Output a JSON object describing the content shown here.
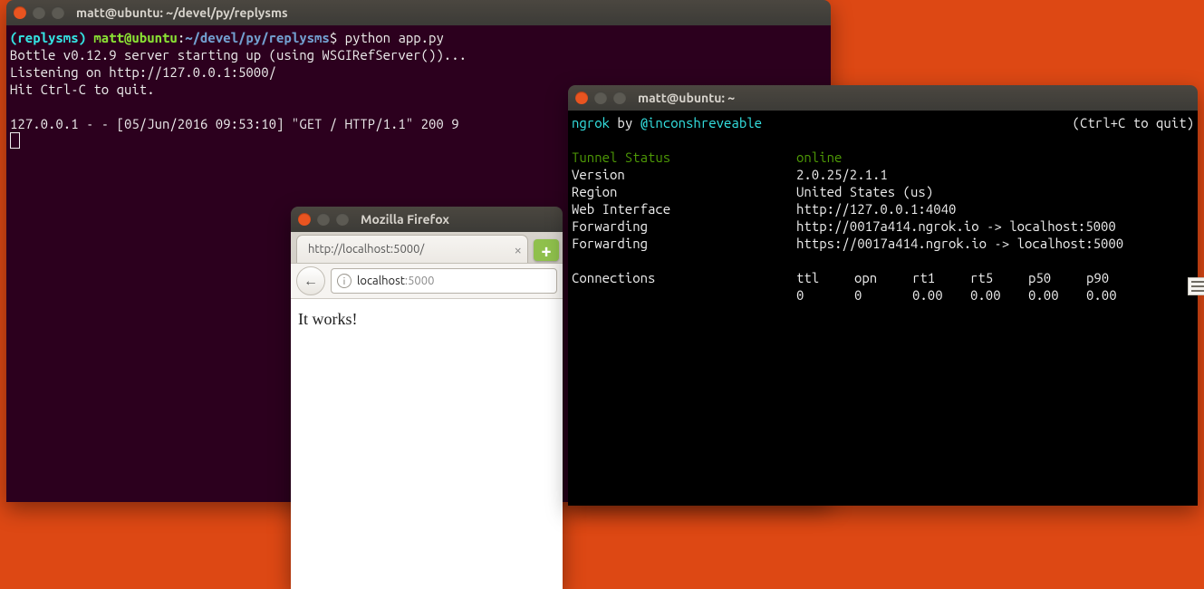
{
  "term1": {
    "title": "matt@ubuntu: ~/devel/py/replysms",
    "prompt_env": "(replysms) ",
    "prompt_userhost": "matt@ubuntu",
    "prompt_sep": ":",
    "prompt_path": "~/devel/py/replysms",
    "prompt_dollar": "$ ",
    "command": "python app.py",
    "line1": "Bottle v0.12.9 server starting up (using WSGIRefServer())...",
    "line2": "Listening on http://127.0.0.1:5000/",
    "line3": "Hit Ctrl-C to quit.",
    "line_blank": "",
    "line4": "127.0.0.1 - - [05/Jun/2016 09:53:10] \"GET / HTTP/1.1\" 200 9"
  },
  "term2": {
    "title": "matt@ubuntu: ~",
    "hdr_app": "ngrok",
    "hdr_by": " by ",
    "hdr_author": "@inconshreveable",
    "hdr_right": "(Ctrl+C to quit)",
    "r1l": "Tunnel Status",
    "r1r": "online",
    "r2l": "Version",
    "r2r": "2.0.25/2.1.1",
    "r3l": "Region",
    "r3r": "United States (us)",
    "r4l": "Web Interface",
    "r4r": "http://127.0.0.1:4040",
    "r5l": "Forwarding",
    "r5r": "http://0017a414.ngrok.io -> localhost:5000",
    "r6l": "Forwarding",
    "r6r": "https://0017a414.ngrok.io -> localhost:5000",
    "conn_label": "Connections",
    "conn_h1": "ttl",
    "conn_h2": "opn",
    "conn_h3": "rt1",
    "conn_h4": "rt5",
    "conn_h5": "p50",
    "conn_h6": "p90",
    "conn_v1": "0",
    "conn_v2": "0",
    "conn_v3": "0.00",
    "conn_v4": "0.00",
    "conn_v5": "0.00",
    "conn_v6": "0.00"
  },
  "firefox": {
    "title": "Mozilla Firefox",
    "tab_label": "http://localhost:5000/",
    "url_host": "localhost",
    "url_port": ":5000",
    "page_text": "It works!"
  }
}
